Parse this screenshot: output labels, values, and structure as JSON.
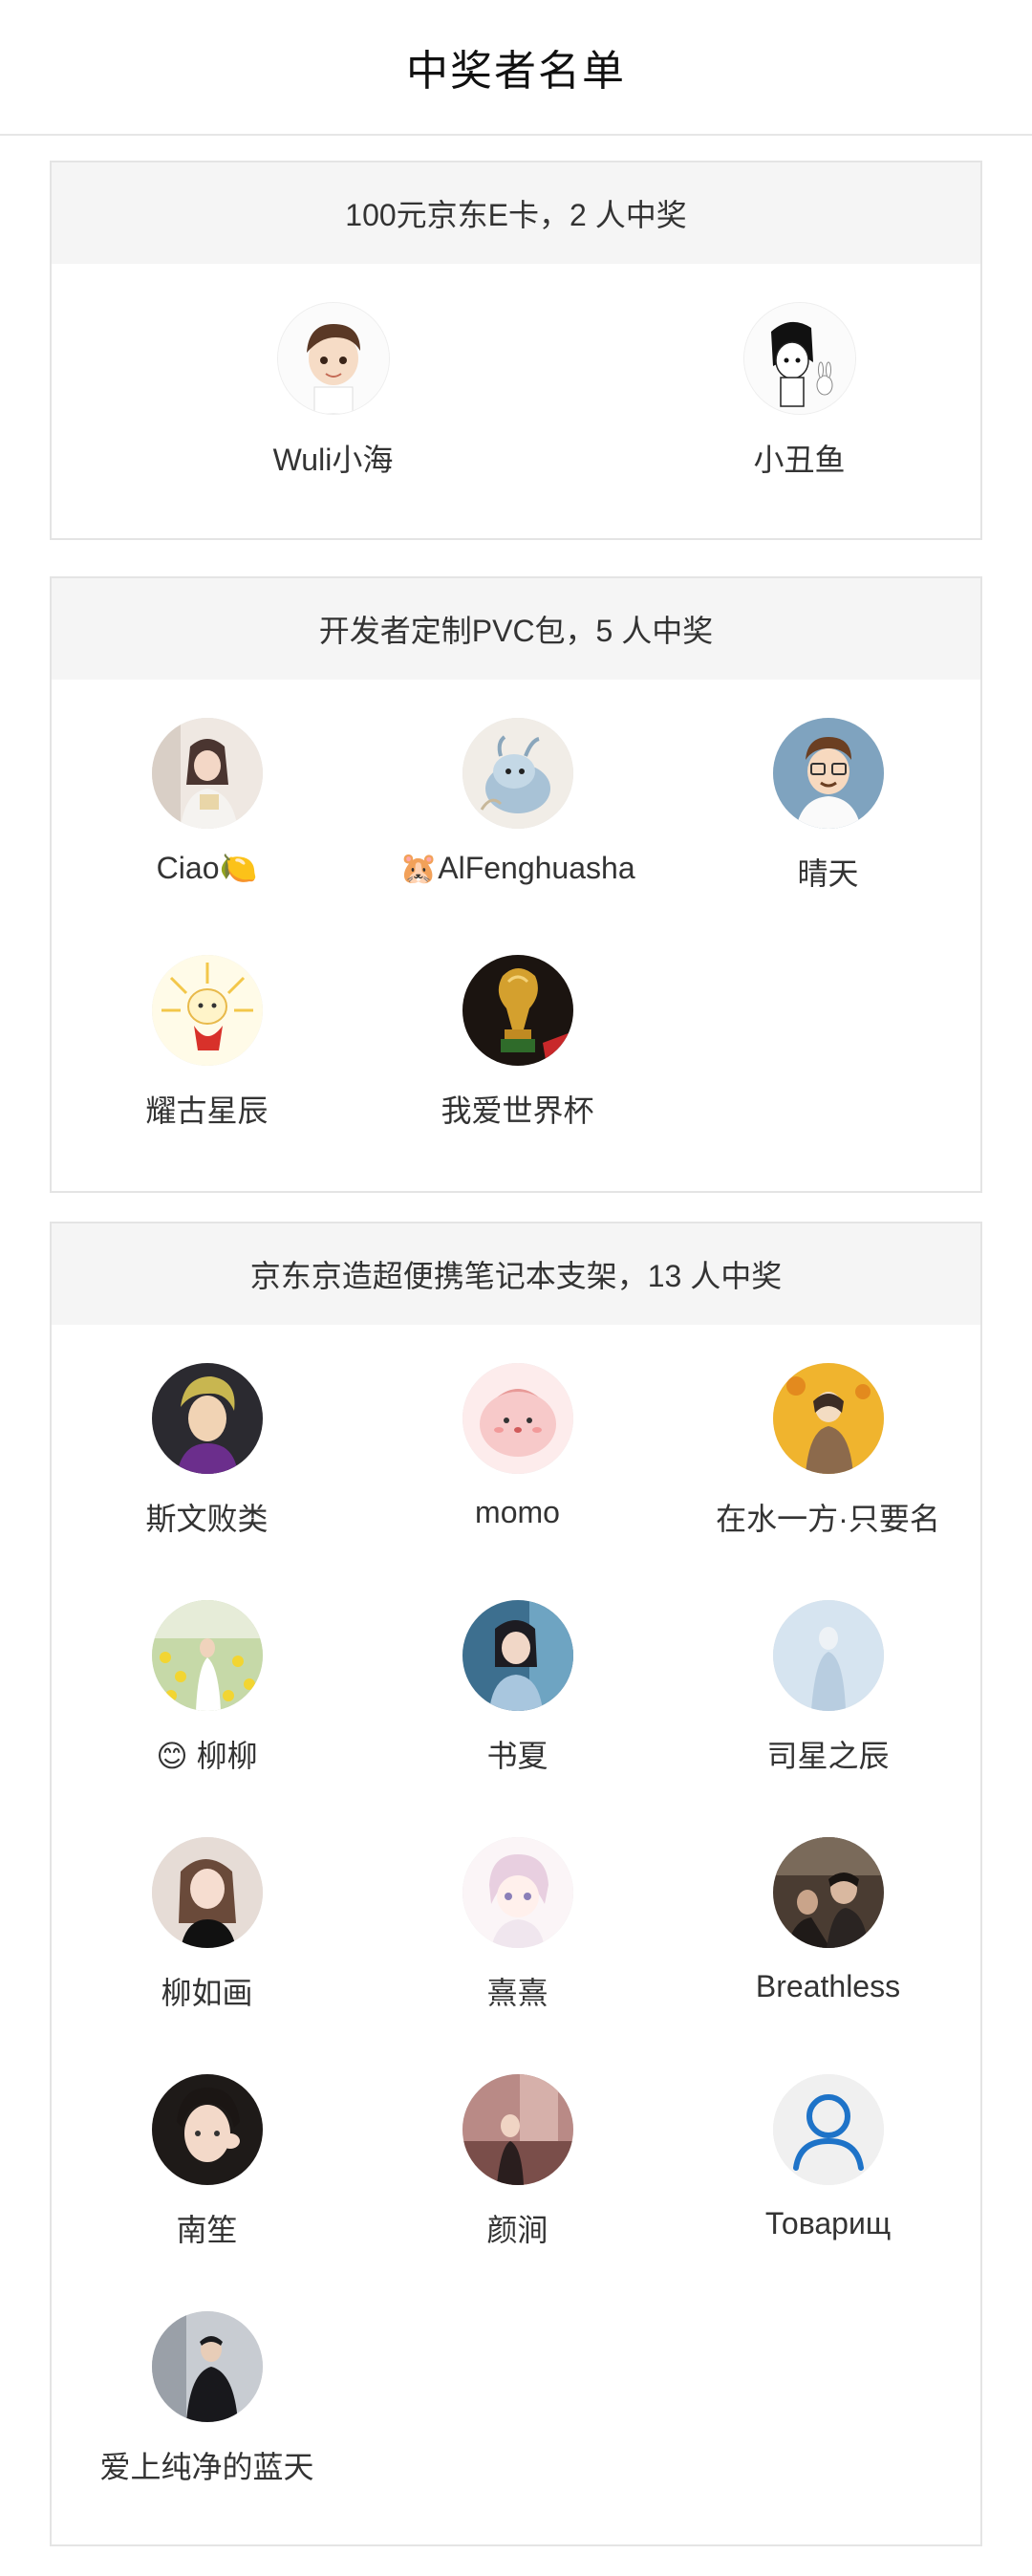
{
  "header": {
    "title": "中奖者名单"
  },
  "prizes": [
    {
      "heading": "100元京东E卡，2 人中奖",
      "winners": [
        {
          "name": "Wuli小海",
          "avatar": "cartoon-boy-avatar"
        },
        {
          "name": "小丑鱼",
          "avatar": "cartoon-girl-bunny-avatar"
        }
      ]
    },
    {
      "heading": "开发者定制PVC包，5 人中奖",
      "winners": [
        {
          "name": "Ciao🍋",
          "avatar": "woman-photo-avatar"
        },
        {
          "name": "🐹AlFenghuasha",
          "avatar": "dragon-avatar"
        },
        {
          "name": "晴天",
          "avatar": "glasses-boy-avatar"
        },
        {
          "name": "耀古星辰",
          "avatar": "sun-character-avatar"
        },
        {
          "name": "我爱世界杯",
          "avatar": "trophy-avatar"
        }
      ]
    },
    {
      "heading": "京东京造超便携笔记本支架，13 人中奖",
      "winners": [
        {
          "name": "斯文败类",
          "avatar": "anime-man-avatar"
        },
        {
          "name": "momo",
          "avatar": "pink-blob-avatar"
        },
        {
          "name": "在水一方·只要名",
          "avatar": "anime-figure-yellow-avatar"
        },
        {
          "name": "😊 柳柳",
          "avatar": "flower-field-avatar"
        },
        {
          "name": "书夏",
          "avatar": "illustrated-girl-avatar"
        },
        {
          "name": "司星之辰",
          "avatar": "misty-figure-avatar"
        },
        {
          "name": "柳如画",
          "avatar": "girl-photo-avatar"
        },
        {
          "name": "熹熹",
          "avatar": "anime-chibi-avatar"
        },
        {
          "name": "Breathless",
          "avatar": "group-photo-avatar"
        },
        {
          "name": "南笙",
          "avatar": "girl-selfie-avatar"
        },
        {
          "name": "颜涧",
          "avatar": "street-photo-avatar"
        },
        {
          "name": "Товарищ",
          "avatar": "default-user-avatar"
        },
        {
          "name": "爱上纯净的蓝天",
          "avatar": "man-in-black-avatar"
        }
      ]
    }
  ],
  "colors": {
    "default_avatar_accent": "#1e73c8",
    "card_head_bg": "#f5f5f5",
    "border": "#e4e4e4"
  }
}
